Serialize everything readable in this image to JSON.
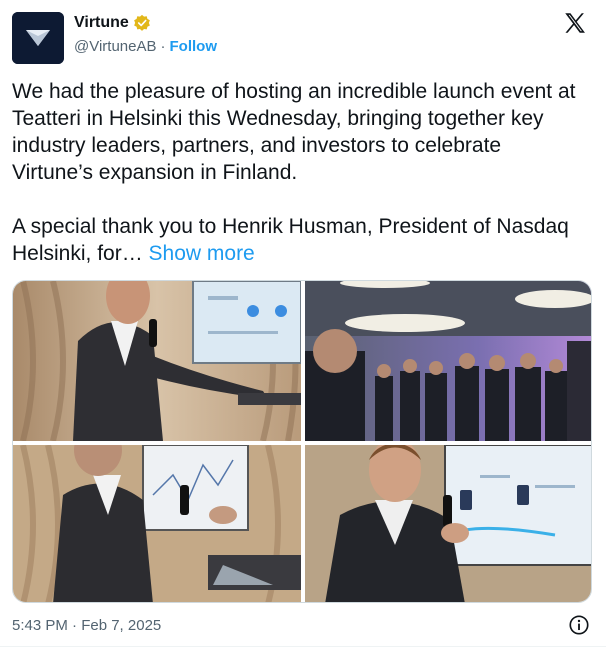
{
  "author": {
    "display_name": "Virtune",
    "handle": "@VirtuneAB",
    "separator": "·",
    "follow_label": "Follow"
  },
  "tweet": {
    "text": "We had the pleasure of hosting an incredible launch event at Teatteri in Helsinki this Wednesday, bringing together key industry leaders, partners, and investors to celebrate Virtune’s expansion in Finland.\n\nA special thank you to Henrik Husman, President of Nasdaq Helsinki, for… ",
    "show_more_label": "Show more"
  },
  "meta": {
    "timestamp": "5:43 PM · Feb 7, 2025"
  },
  "icons": {
    "verified": "verified-badge-icon",
    "x_logo": "x-logo-icon",
    "info": "info-icon"
  },
  "colors": {
    "accent": "#1d9bf0",
    "verified_gold": "#e2b719",
    "text": "#0f1419",
    "muted": "#536471",
    "avatar_bg": "#0d1a33"
  }
}
